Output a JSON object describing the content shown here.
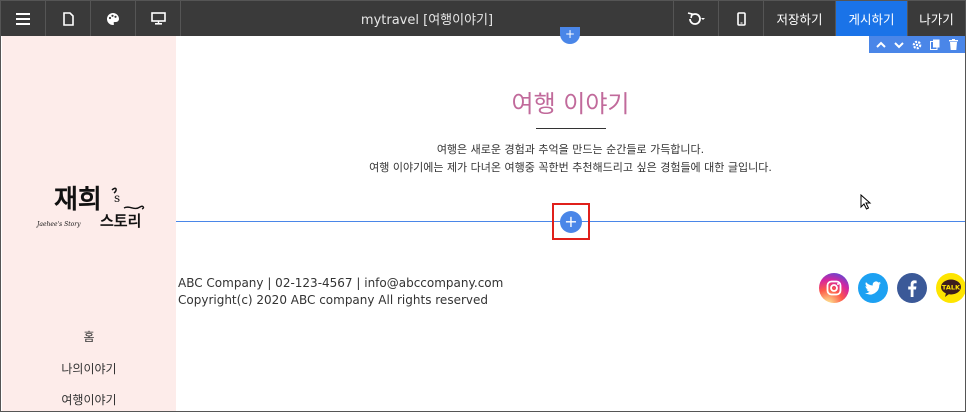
{
  "toolbar": {
    "title": "mytravel [여행이야기]",
    "save_label": "저장하기",
    "publish_label": "게시하기",
    "exit_label": "나가기",
    "publish_color": "#1a73e8"
  },
  "sidebar": {
    "nav": [
      {
        "label": "홈"
      },
      {
        "label": "나의이야기"
      },
      {
        "label": "여행이야기"
      }
    ],
    "background": "#fdecea"
  },
  "main": {
    "heading": "여행 이야기",
    "description_line1": "여행은 새로운 경험과 추억을 만드는 순간들로 가득합니다.",
    "description_line2": "여행 이야기에는 제가 다녀온 여행중 꼭한번 추천해드리고 싶은 경험들에 대한 글입니다.",
    "heading_color": "#c16a9b"
  },
  "footer": {
    "line1": "ABC Company | 02-123-4567 | info@abccompany.com",
    "line2": "Copyright(c) 2020 ABC company All rights reserved",
    "kakao_label": "TALK"
  },
  "icons": [
    "menu-icon",
    "page-icon",
    "palette-icon",
    "monitor-icon",
    "undo-icon",
    "mobile-icon",
    "chevron-up-icon",
    "chevron-down-icon",
    "gear-icon",
    "copy-icon",
    "trash-icon",
    "plus-icon",
    "instagram-icon",
    "twitter-icon",
    "facebook-icon",
    "kakaotalk-icon"
  ]
}
